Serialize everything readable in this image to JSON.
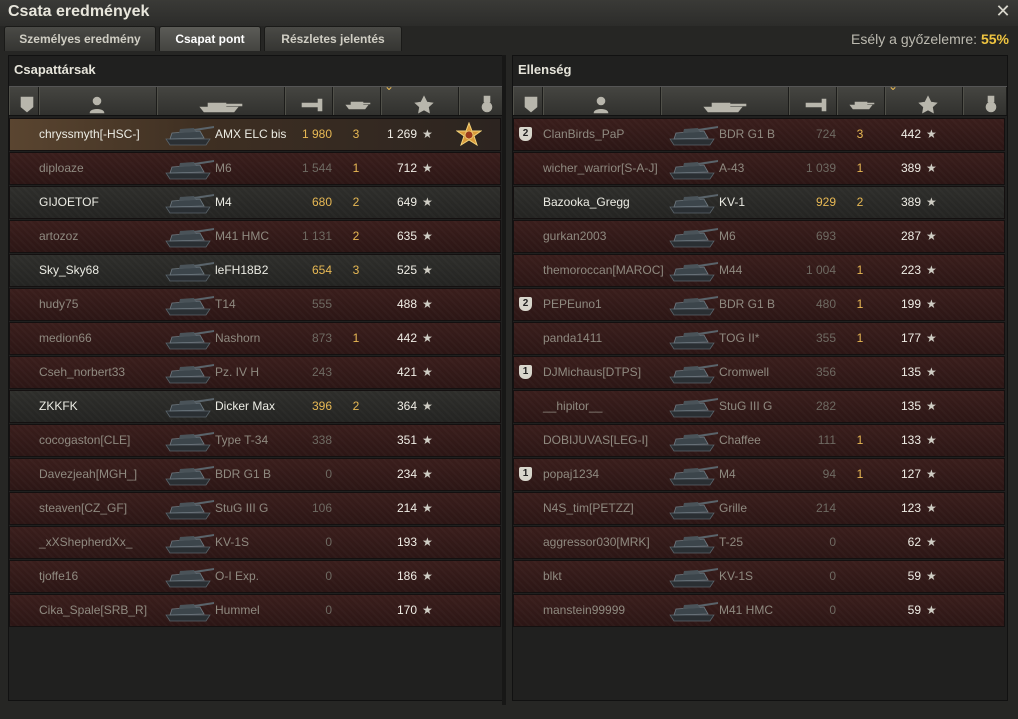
{
  "window": {
    "title": "Csata eredmények"
  },
  "tabs": [
    {
      "label": "Személyes eredmény"
    },
    {
      "label": "Csapat pont"
    },
    {
      "label": "Részletes jelentés"
    }
  ],
  "win_chance": {
    "label": "Esély a győzelemre:",
    "value": "55%"
  },
  "colors": {
    "accent": "#f0c540",
    "dead_row": "#3a1e1c",
    "alive_row": "#2e2e2b",
    "damage": "#e8b954"
  },
  "allies": {
    "title": "Csapattársak",
    "rows": [
      {
        "player": "chryssmyth[-HSC-]",
        "vehicle": "AMX ELC bis",
        "damage": "1 980",
        "kills": "3",
        "points": "1 269",
        "alive": true,
        "me": true,
        "medal": true
      },
      {
        "player": "diploaze",
        "vehicle": "M6",
        "damage": "1 544",
        "kills": "1",
        "points": "712",
        "alive": false
      },
      {
        "player": "GIJOETOF",
        "vehicle": "M4",
        "damage": "680",
        "kills": "2",
        "points": "649",
        "alive": true
      },
      {
        "player": "artozoz",
        "vehicle": "M41 HMC",
        "damage": "1 131",
        "kills": "2",
        "points": "635",
        "alive": false
      },
      {
        "player": "Sky_Sky68",
        "vehicle": "leFH18B2",
        "damage": "654",
        "kills": "3",
        "points": "525",
        "alive": true
      },
      {
        "player": "hudy75",
        "vehicle": "T14",
        "damage": "555",
        "kills": "",
        "points": "488",
        "alive": false
      },
      {
        "player": "medion66",
        "vehicle": "Nashorn",
        "damage": "873",
        "kills": "1",
        "points": "442",
        "alive": false
      },
      {
        "player": "Cseh_norbert33",
        "vehicle": "Pz. IV H",
        "damage": "243",
        "kills": "",
        "points": "421",
        "alive": false
      },
      {
        "player": "ZKKFK",
        "vehicle": "Dicker Max",
        "damage": "396",
        "kills": "2",
        "points": "364",
        "alive": true
      },
      {
        "player": "cocogaston[CLE]",
        "vehicle": "Type T-34",
        "damage": "338",
        "kills": "",
        "points": "351",
        "alive": false
      },
      {
        "player": "Davezjeah[MGH_]",
        "vehicle": "BDR G1 B",
        "damage": "0",
        "kills": "",
        "points": "234",
        "alive": false
      },
      {
        "player": "steaven[CZ_GF]",
        "vehicle": "StuG III G",
        "damage": "106",
        "kills": "",
        "points": "214",
        "alive": false
      },
      {
        "player": "_xXShepherdXx_",
        "vehicle": "KV-1S",
        "damage": "0",
        "kills": "",
        "points": "193",
        "alive": false
      },
      {
        "player": "tjoffe16",
        "vehicle": "O-I Exp.",
        "damage": "0",
        "kills": "",
        "points": "186",
        "alive": false
      },
      {
        "player": "Cika_Spale[SRB_R]",
        "vehicle": "Hummel",
        "damage": "0",
        "kills": "",
        "points": "170",
        "alive": false
      }
    ]
  },
  "enemies": {
    "title": "Ellenség",
    "rows": [
      {
        "player": "ClanBirds_PaP",
        "vehicle": "BDR G1 B",
        "damage": "724",
        "kills": "3",
        "points": "442",
        "alive": false,
        "platoon": "2"
      },
      {
        "player": "wicher_warrior[S-A-J]",
        "vehicle": "A-43",
        "damage": "1 039",
        "kills": "1",
        "points": "389",
        "alive": false
      },
      {
        "player": "Bazooka_Gregg",
        "vehicle": "KV-1",
        "damage": "929",
        "kills": "2",
        "points": "389",
        "alive": true
      },
      {
        "player": "gurkan2003",
        "vehicle": "M6",
        "damage": "693",
        "kills": "",
        "points": "287",
        "alive": false
      },
      {
        "player": "themoroccan[MAROC]",
        "vehicle": "M44",
        "damage": "1 004",
        "kills": "1",
        "points": "223",
        "alive": false
      },
      {
        "player": "PEPEuno1",
        "vehicle": "BDR G1 B",
        "damage": "480",
        "kills": "1",
        "points": "199",
        "alive": false,
        "platoon": "2"
      },
      {
        "player": "panda1411",
        "vehicle": "TOG II*",
        "damage": "355",
        "kills": "1",
        "points": "177",
        "alive": false
      },
      {
        "player": "DJMichaus[DTPS]",
        "vehicle": "Cromwell",
        "damage": "356",
        "kills": "",
        "points": "135",
        "alive": false,
        "platoon": "1"
      },
      {
        "player": "__hipitor__",
        "vehicle": "StuG III G",
        "damage": "282",
        "kills": "",
        "points": "135",
        "alive": false
      },
      {
        "player": "DOBIJUVAS[LEG-I]",
        "vehicle": "Chaffee",
        "damage": "111",
        "kills": "1",
        "points": "133",
        "alive": false
      },
      {
        "player": "popaj1234",
        "vehicle": "M4",
        "damage": "94",
        "kills": "1",
        "points": "127",
        "alive": false,
        "platoon": "1"
      },
      {
        "player": "N4S_tim[PETZZ]",
        "vehicle": "Grille",
        "damage": "214",
        "kills": "",
        "points": "123",
        "alive": false
      },
      {
        "player": "aggressor030[MRK]",
        "vehicle": "T-25",
        "damage": "0",
        "kills": "",
        "points": "62",
        "alive": false
      },
      {
        "player": "blkt",
        "vehicle": "KV-1S",
        "damage": "0",
        "kills": "",
        "points": "59",
        "alive": false
      },
      {
        "player": "manstein99999",
        "vehicle": "M41 HMC",
        "damage": "0",
        "kills": "",
        "points": "59",
        "alive": false
      }
    ]
  },
  "icons": {
    "col_squad": "squad-icon",
    "col_player": "player-icon",
    "col_vehicle": "tank-icon",
    "col_damage": "damage-icon",
    "col_kills": "kills-icon",
    "col_points": "star-icon",
    "col_medal": "medal-icon",
    "sort": "sort-arrow-icon",
    "close": "close-icon"
  },
  "star_glyph": "★"
}
